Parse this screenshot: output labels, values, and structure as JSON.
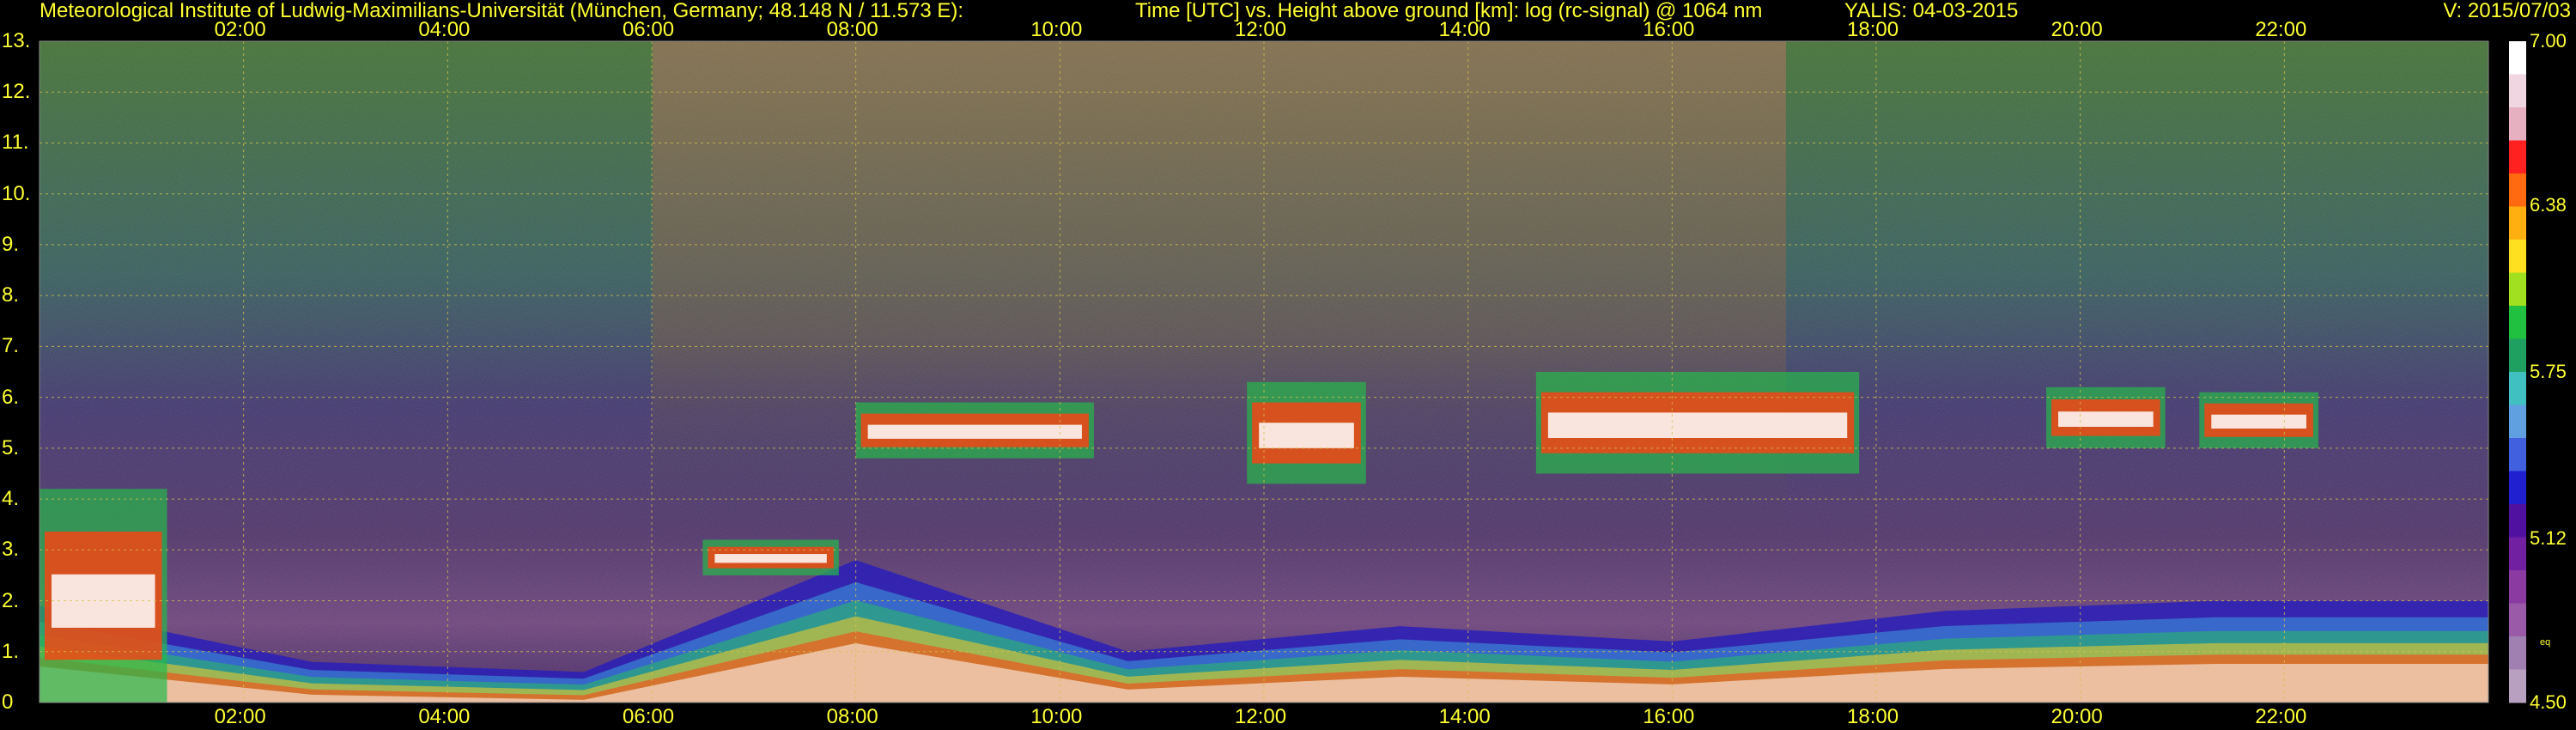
{
  "header": {
    "institute": "Meteorological Institute of Ludwig-Maximilians-Universität (München, Germany; 48.148 N / 11.573 E):",
    "title": "Time [UTC] vs. Height above ground [km]: log (rc-signal) @ 1064 nm",
    "station": "YALIS: 04-03-2015",
    "version": "V: 2015/07/03"
  },
  "colors": {
    "text": "#ffff33",
    "grid": "#d6c24a",
    "background": "#000000"
  },
  "chart_data": {
    "type": "heatmap",
    "x_axis": {
      "range": [
        "00:00",
        "24:00"
      ],
      "tick_labels": [
        "02:00",
        "04:00",
        "06:00",
        "08:00",
        "10:00",
        "12:00",
        "14:00",
        "16:00",
        "18:00",
        "20:00",
        "22:00"
      ]
    },
    "y_axis": {
      "range": [
        0,
        13
      ],
      "unit": "km",
      "tick_labels": [
        "0",
        "1.",
        "2.",
        "3.",
        "4.",
        "5.",
        "6.",
        "7.",
        "8.",
        "9.",
        "10.",
        "11.",
        "12.",
        "13."
      ]
    },
    "colorbar": {
      "range": [
        4.5,
        7.0
      ],
      "tick_labels": [
        "4.50",
        "5.12",
        "5.75",
        "6.38",
        "7.00"
      ],
      "small_label": "eq"
    },
    "grid": true,
    "features": [
      {
        "kind": "boundary_layer_aerosol",
        "x_start": "00:00",
        "x_end": "24:00",
        "top_km": [
          1.9,
          0.8,
          0.6,
          2.8,
          1.0,
          1.5,
          1.2,
          1.8,
          2.0,
          2.0
        ]
      },
      {
        "kind": "residual_layer",
        "x_start": "00:00",
        "x_end": "01:15",
        "top_km": 4.2
      },
      {
        "kind": "elevated_layer",
        "x_start": "06:30",
        "x_end": "07:50",
        "base_km": 2.5,
        "top_km": 3.2
      },
      {
        "kind": "mid_level_cloud",
        "x_start": "08:00",
        "x_end": "10:20",
        "base_km": 4.8,
        "top_km": 5.9
      },
      {
        "kind": "mid_level_cloud",
        "x_start": "11:50",
        "x_end": "13:00",
        "base_km": 4.3,
        "top_km": 6.3
      },
      {
        "kind": "mid_level_cloud",
        "x_start": "14:40",
        "x_end": "17:50",
        "base_km": 4.5,
        "top_km": 6.5
      },
      {
        "kind": "mid_level_cloud",
        "x_start": "19:40",
        "x_end": "20:50",
        "base_km": 5.0,
        "top_km": 6.2
      },
      {
        "kind": "mid_level_cloud",
        "x_start": "21:10",
        "x_end": "22:20",
        "base_km": 5.0,
        "top_km": 6.1
      }
    ]
  }
}
